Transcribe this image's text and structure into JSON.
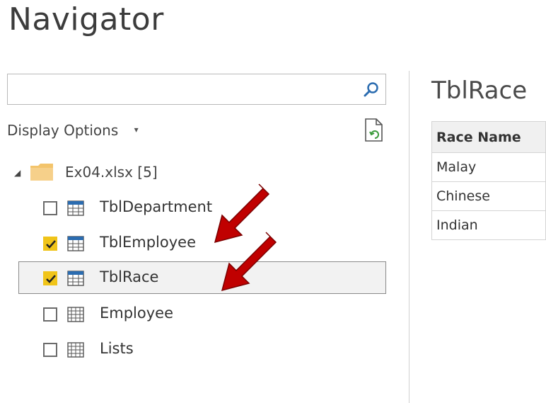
{
  "window": {
    "title": "Navigator"
  },
  "search": {
    "value": "",
    "placeholder": "",
    "icon": "search-icon"
  },
  "display_options": {
    "label": "Display Options",
    "caret": "▾"
  },
  "refresh": {
    "icon": "refresh-icon"
  },
  "tree": {
    "root": {
      "label": "Ex04.xlsx [5]",
      "expanded": true,
      "icon": "folder-icon"
    },
    "items": [
      {
        "label": "TblDepartment",
        "checked": false,
        "selected": false,
        "icon": "table-icon"
      },
      {
        "label": "TblEmployee",
        "checked": true,
        "selected": false,
        "icon": "table-icon"
      },
      {
        "label": "TblRace",
        "checked": true,
        "selected": true,
        "icon": "table-icon"
      },
      {
        "label": "Employee",
        "checked": false,
        "selected": false,
        "icon": "sheet-icon"
      },
      {
        "label": "Lists",
        "checked": false,
        "selected": false,
        "icon": "sheet-icon"
      }
    ]
  },
  "preview": {
    "title": "TblRace",
    "columns": [
      "Race Name"
    ],
    "rows": [
      [
        "Malay"
      ],
      [
        "Chinese"
      ],
      [
        "Indian"
      ]
    ]
  },
  "colors": {
    "checkbox_checked": "#f0c419",
    "folder": "#f3c46b",
    "table_icon": "#2b6cb0",
    "arrow": "#c00000"
  }
}
